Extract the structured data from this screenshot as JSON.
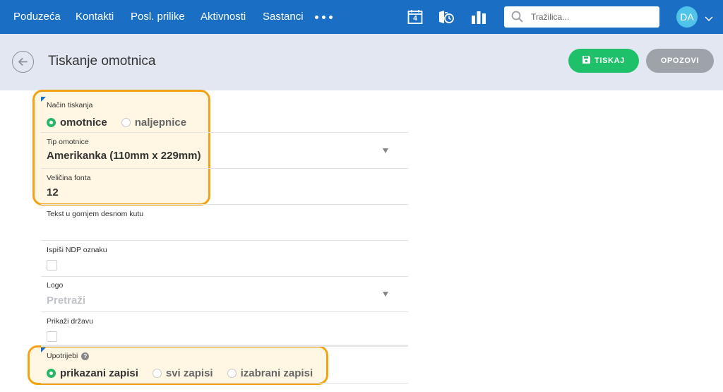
{
  "nav": {
    "items": [
      "Poduzeća",
      "Kontakti",
      "Posl. prilike",
      "Aktivnosti",
      "Sastanci"
    ],
    "calendar_day": "4",
    "icons": [
      "more-icon",
      "calendar-icon",
      "call-log-icon",
      "reports-icon"
    ]
  },
  "search": {
    "placeholder": "Tražilica..."
  },
  "user": {
    "initials": "DA"
  },
  "header": {
    "title": "Tiskanje omotnica",
    "print_label": "TISKAJ",
    "cancel_label": "OPOZOVI"
  },
  "form": {
    "print_mode": {
      "label": "Način tiskanja",
      "options": [
        "omotnice",
        "naljepnice"
      ],
      "selected": "omotnice"
    },
    "envelope_type": {
      "label": "Tip omotnice",
      "value": "Amerikanka (110mm x 229mm)"
    },
    "font_size": {
      "label": "Veličina fonta",
      "value": "12"
    },
    "top_right_text": {
      "label": "Tekst u gornjem desnom kutu",
      "value": ""
    },
    "ndp_label": {
      "label": "Ispiši NDP oznaku",
      "checked": false
    },
    "logo": {
      "label": "Logo",
      "placeholder": "Pretraži"
    },
    "show_country": {
      "label": "Prikaži državu",
      "checked": false
    },
    "use": {
      "label": "Upotrijebi",
      "help": "?",
      "options": [
        "prikazani zapisi",
        "svi zapisi",
        "izabrani zapisi"
      ],
      "selected": "prikazani zapisi"
    }
  },
  "colors": {
    "topbar": "#1a6fc4",
    "subheader": "#e3e7f1",
    "primary_button": "#1fc06a",
    "secondary_button": "#9ea3aa",
    "highlight": "#f2a313",
    "radio_selected": "#29b765"
  }
}
